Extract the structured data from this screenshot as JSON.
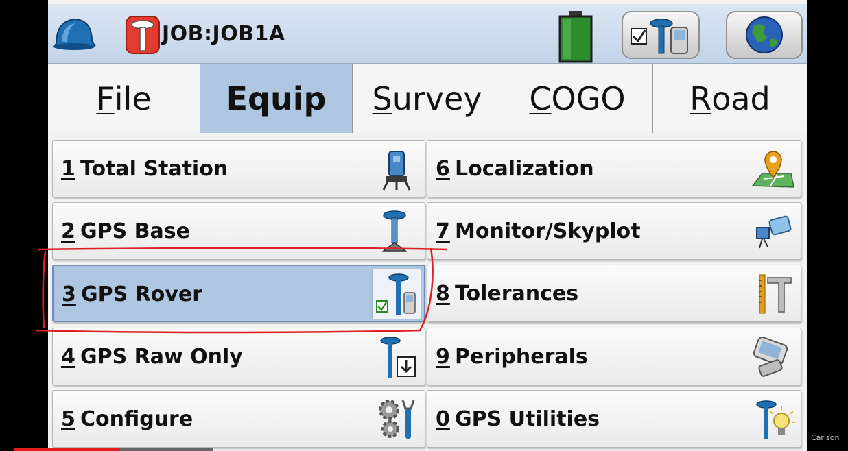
{
  "header": {
    "job_title": "JOB:JOB1A",
    "battery_color": "#2e8b2e",
    "icons": [
      "hardhat-icon",
      "job-icon",
      "battery-icon",
      "gps-rover-status-icon",
      "globe-icon"
    ]
  },
  "tabs": [
    {
      "first": "F",
      "rest": "ile",
      "active": false
    },
    {
      "first": "",
      "rest": "Equip",
      "active": true
    },
    {
      "first": "S",
      "rest": "urvey",
      "active": false
    },
    {
      "first": "C",
      "rest": "OGO",
      "active": false
    },
    {
      "first": "R",
      "rest": "oad",
      "active": false
    }
  ],
  "menu": {
    "left": [
      {
        "num": "1",
        "label": "Total Station",
        "icon": "total-station-icon"
      },
      {
        "num": "2",
        "label": "GPS Base",
        "icon": "gps-base-icon"
      },
      {
        "num": "3",
        "label": "GPS Rover",
        "icon": "gps-rover-icon",
        "selected": true
      },
      {
        "num": "4",
        "label": "GPS Raw Only",
        "icon": "gps-raw-icon"
      },
      {
        "num": "5",
        "label": "Configure",
        "icon": "gears-icon"
      }
    ],
    "right": [
      {
        "num": "6",
        "label": "Localization",
        "icon": "map-pin-icon"
      },
      {
        "num": "7",
        "label": "Monitor/Skyplot",
        "icon": "satellite-icon"
      },
      {
        "num": "8",
        "label": "Tolerances",
        "icon": "caliper-icon"
      },
      {
        "num": "9",
        "label": "Peripherals",
        "icon": "handheld-icon"
      },
      {
        "num": "0",
        "label": "GPS Utilities",
        "icon": "gps-utilities-icon"
      }
    ]
  },
  "annotation_color": "#e02020",
  "watermark": "Carlson"
}
